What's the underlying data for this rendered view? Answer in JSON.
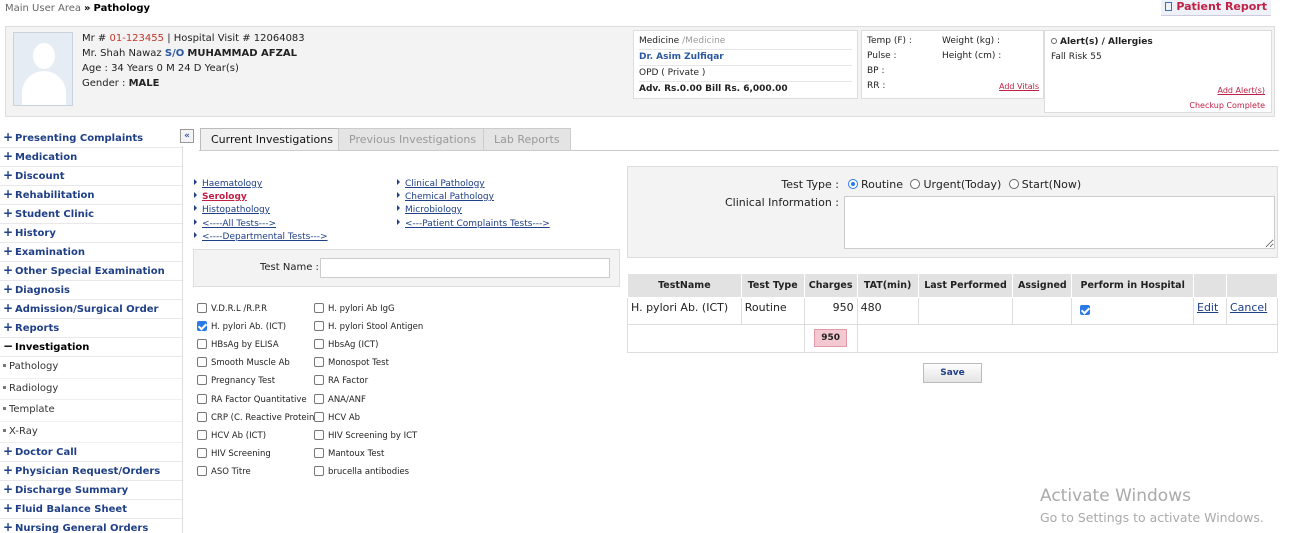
{
  "breadcrumb": {
    "root": "Main User Area",
    "sep": "»",
    "current": "Pathology"
  },
  "patient_report_label": "Patient Report",
  "patient": {
    "mr_label": "Mr #",
    "mr": "01-123455",
    "visit": "| Hospital Visit # 12064083",
    "name": "Mr. Shah Nawaz",
    "relation": "S/O",
    "father": "MUHAMMAD AFZAL",
    "age": "Age : 34 Years 0 M 24 D Year(s)",
    "gender_label": "Gender :",
    "gender": "MALE"
  },
  "doctor": {
    "dept": "Medicine",
    "dept2": "/Medicine",
    "name": "Dr. Asim Zulfiqar",
    "type": "OPD ( Private )",
    "bill": "Adv. Rs.0.00 Bill Rs. 6,000.00"
  },
  "vitals": {
    "temp": "Temp (F) :",
    "weight": "Weight (kg) :",
    "pulse": "Pulse :",
    "height": "Height (cm) :",
    "bp": "BP :",
    "rr": "RR :",
    "add": "Add Vitals"
  },
  "alerts": {
    "title": "Alert(s) / Allergies",
    "item": "Fall Risk 55",
    "add": "Add Alert(s)",
    "checkup": "Checkup Complete"
  },
  "nav": {
    "collapse": "«",
    "items": [
      "Presenting Complaints",
      "Medication",
      "Discount",
      "Rehabilitation",
      "Student Clinic",
      "History",
      "Examination",
      "Other Special Examination",
      "Diagnosis",
      "Admission/Surgical Order",
      "Reports"
    ],
    "open": "Investigation",
    "subs": [
      "Pathology",
      "Radiology",
      "Template",
      "X-Ray"
    ],
    "after": [
      "Doctor Call",
      "Physician Request/Orders",
      "Discharge Summary",
      "Fluid Balance Sheet",
      "Nursing General Orders"
    ]
  },
  "tabs": [
    "Current Investigations",
    "Previous Investigations",
    "Lab Reports"
  ],
  "links": {
    "col1": [
      "Haematology",
      "Serology",
      "Histopathology",
      "<----All Tests--->",
      "<----Departmental Tests--->"
    ],
    "col2": [
      "Clinical Pathology",
      "Chemical Pathology",
      "Microbiology",
      "<---Patient Complaints Tests--->"
    ]
  },
  "test_name_label": "Test Name :",
  "checks": {
    "col1": [
      "V.D.R.L /R.P.R",
      "H. pylori Ab. (ICT)",
      "HBsAg by ELISA",
      "Smooth Muscle Ab",
      "Pregnancy Test",
      "RA Factor Quantitative",
      "CRP (C. Reactive Protein)",
      "HCV Ab (ICT)",
      "HIV Screening",
      "ASO Titre"
    ],
    "col2": [
      "H. pylori Ab IgG",
      "H. pylori Stool Antigen",
      "HbsAg (ICT)",
      "Monospot Test",
      "RA Factor",
      "ANA/ANF",
      "HCV Ab",
      "HIV Screening by ICT",
      "Mantoux Test",
      "brucella antibodies"
    ],
    "checked": "H. pylori Ab. (ICT)"
  },
  "test_type": {
    "label": "Test Type :",
    "options": [
      "Routine",
      "Urgent(Today)",
      "Start(Now)"
    ],
    "selected": "Routine"
  },
  "clinical_info_label": "Clinical Information :",
  "grid": {
    "headers": [
      "TestName",
      "Test Type",
      "Charges",
      "TAT(min)",
      "Last Performed",
      "Assigned",
      "Perform in Hospital",
      "",
      ""
    ],
    "row": {
      "test": "H. pylori Ab. (ICT)",
      "type": "Routine",
      "charges": "950",
      "tat": "480",
      "last": "",
      "assigned": "",
      "edit": "Edit",
      "cancel": "Cancel"
    },
    "total": "950"
  },
  "save_label": "Save",
  "watermark": {
    "title": "Activate Windows",
    "sub": "Go to Settings to activate Windows."
  },
  "colors": {
    "link": "#1f3f86",
    "accent_red": "#c02046",
    "checkbox": "#2b7be4"
  }
}
